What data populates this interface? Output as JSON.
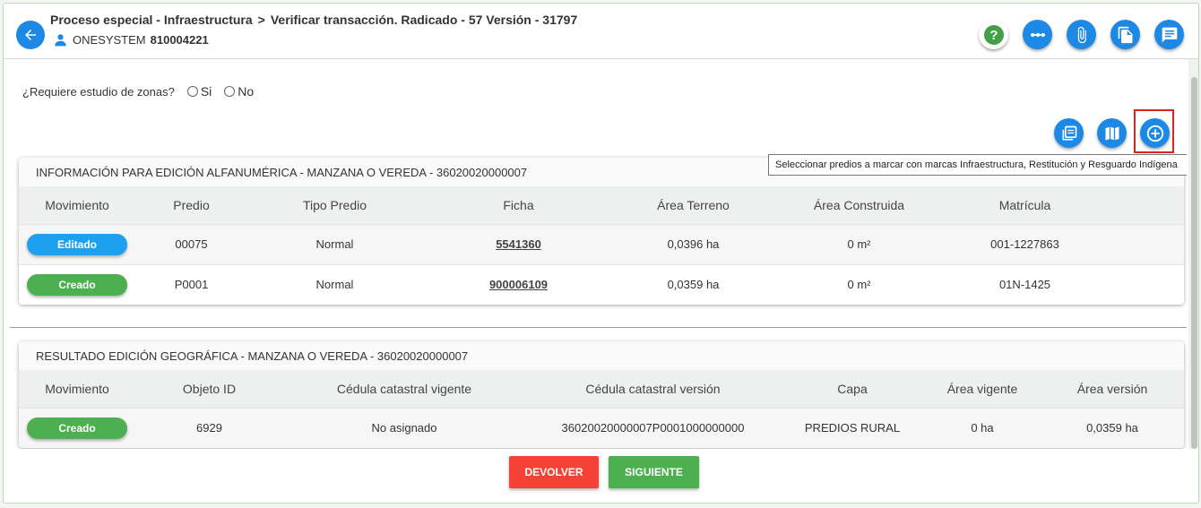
{
  "header": {
    "breadcrumb_process": "Proceso especial - Infraestructura",
    "breadcrumb_separator": ">",
    "breadcrumb_task": "Verificar transacción. Radicado - 57 Versión - 31797",
    "user_name": "ONESYSTEM",
    "user_code": "810004221",
    "icons": [
      "help-icon",
      "more-icon",
      "attachment-icon",
      "document-icon",
      "comments-icon"
    ]
  },
  "zone_question": {
    "label": "¿Requiere estudio de zonas?",
    "options": [
      "Si",
      "No"
    ]
  },
  "tools": {
    "icons": [
      "copy-layers-icon",
      "map-icon",
      "add-icon"
    ],
    "tooltip": "Seleccionar predios a marcar con marcas Infraestructura, Restitución y Resguardo Indígena"
  },
  "alfanumerica": {
    "title": "INFORMACIÓN PARA EDICIÓN ALFANUMÉRICA - MANZANA O VEREDA - 36020020000007",
    "columns": [
      "Movimiento",
      "Predio",
      "Tipo Predio",
      "Ficha",
      "Área Terreno",
      "Área Construida",
      "Matrícula"
    ],
    "rows": [
      {
        "movimiento": "Editado",
        "predio": "00075",
        "tipo": "Normal",
        "ficha": "5541360",
        "area_terreno": "0,0396 ha",
        "area_construida": "0 m²",
        "matricula": "001-1227863"
      },
      {
        "movimiento": "Creado",
        "predio": "P0001",
        "tipo": "Normal",
        "ficha": "900006109",
        "area_terreno": "0,0359 ha",
        "area_construida": "0 m²",
        "matricula": "01N-1425"
      }
    ]
  },
  "geografica": {
    "title": "RESULTADO EDICIÓN GEOGRÁFICA - MANZANA O VEREDA - 36020020000007",
    "columns": [
      "Movimiento",
      "Objeto ID",
      "Cédula catastral vigente",
      "Cédula catastral versión",
      "Capa",
      "Área vigente",
      "Área versión"
    ],
    "rows": [
      {
        "movimiento": "Creado",
        "objeto_id": "6929",
        "cedula_vigente": "No asignado",
        "cedula_version": "36020020000007P0001000000000",
        "capa": "PREDIOS RURAL",
        "area_vigente": "0 ha",
        "area_version": "0,0359 ha"
      }
    ]
  },
  "footer": {
    "devolver": "DEVOLVER",
    "siguiente": "SIGUIENTE"
  },
  "colors": {
    "primary": "#1e88e5",
    "editado": "#1ea0f0",
    "creado": "#4caf50",
    "devolver": "#f44336",
    "siguiente": "#4caf50",
    "help": "#43a047",
    "highlight": "#e0211d"
  }
}
